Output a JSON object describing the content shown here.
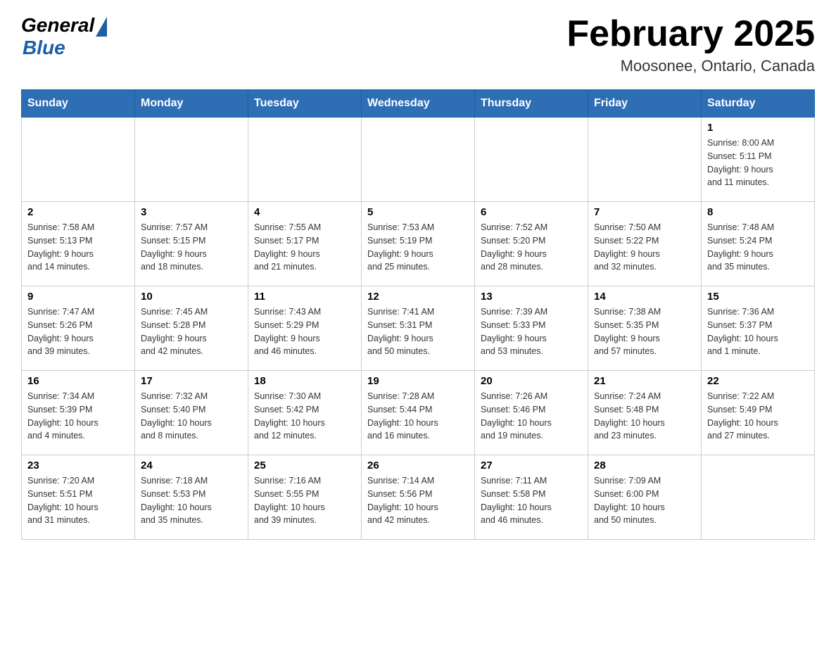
{
  "header": {
    "logo_general": "General",
    "logo_blue": "Blue",
    "month_title": "February 2025",
    "location": "Moosonee, Ontario, Canada"
  },
  "days_of_week": [
    "Sunday",
    "Monday",
    "Tuesday",
    "Wednesday",
    "Thursday",
    "Friday",
    "Saturday"
  ],
  "weeks": [
    [
      {
        "day": "",
        "info": ""
      },
      {
        "day": "",
        "info": ""
      },
      {
        "day": "",
        "info": ""
      },
      {
        "day": "",
        "info": ""
      },
      {
        "day": "",
        "info": ""
      },
      {
        "day": "",
        "info": ""
      },
      {
        "day": "1",
        "info": "Sunrise: 8:00 AM\nSunset: 5:11 PM\nDaylight: 9 hours\nand 11 minutes."
      }
    ],
    [
      {
        "day": "2",
        "info": "Sunrise: 7:58 AM\nSunset: 5:13 PM\nDaylight: 9 hours\nand 14 minutes."
      },
      {
        "day": "3",
        "info": "Sunrise: 7:57 AM\nSunset: 5:15 PM\nDaylight: 9 hours\nand 18 minutes."
      },
      {
        "day": "4",
        "info": "Sunrise: 7:55 AM\nSunset: 5:17 PM\nDaylight: 9 hours\nand 21 minutes."
      },
      {
        "day": "5",
        "info": "Sunrise: 7:53 AM\nSunset: 5:19 PM\nDaylight: 9 hours\nand 25 minutes."
      },
      {
        "day": "6",
        "info": "Sunrise: 7:52 AM\nSunset: 5:20 PM\nDaylight: 9 hours\nand 28 minutes."
      },
      {
        "day": "7",
        "info": "Sunrise: 7:50 AM\nSunset: 5:22 PM\nDaylight: 9 hours\nand 32 minutes."
      },
      {
        "day": "8",
        "info": "Sunrise: 7:48 AM\nSunset: 5:24 PM\nDaylight: 9 hours\nand 35 minutes."
      }
    ],
    [
      {
        "day": "9",
        "info": "Sunrise: 7:47 AM\nSunset: 5:26 PM\nDaylight: 9 hours\nand 39 minutes."
      },
      {
        "day": "10",
        "info": "Sunrise: 7:45 AM\nSunset: 5:28 PM\nDaylight: 9 hours\nand 42 minutes."
      },
      {
        "day": "11",
        "info": "Sunrise: 7:43 AM\nSunset: 5:29 PM\nDaylight: 9 hours\nand 46 minutes."
      },
      {
        "day": "12",
        "info": "Sunrise: 7:41 AM\nSunset: 5:31 PM\nDaylight: 9 hours\nand 50 minutes."
      },
      {
        "day": "13",
        "info": "Sunrise: 7:39 AM\nSunset: 5:33 PM\nDaylight: 9 hours\nand 53 minutes."
      },
      {
        "day": "14",
        "info": "Sunrise: 7:38 AM\nSunset: 5:35 PM\nDaylight: 9 hours\nand 57 minutes."
      },
      {
        "day": "15",
        "info": "Sunrise: 7:36 AM\nSunset: 5:37 PM\nDaylight: 10 hours\nand 1 minute."
      }
    ],
    [
      {
        "day": "16",
        "info": "Sunrise: 7:34 AM\nSunset: 5:39 PM\nDaylight: 10 hours\nand 4 minutes."
      },
      {
        "day": "17",
        "info": "Sunrise: 7:32 AM\nSunset: 5:40 PM\nDaylight: 10 hours\nand 8 minutes."
      },
      {
        "day": "18",
        "info": "Sunrise: 7:30 AM\nSunset: 5:42 PM\nDaylight: 10 hours\nand 12 minutes."
      },
      {
        "day": "19",
        "info": "Sunrise: 7:28 AM\nSunset: 5:44 PM\nDaylight: 10 hours\nand 16 minutes."
      },
      {
        "day": "20",
        "info": "Sunrise: 7:26 AM\nSunset: 5:46 PM\nDaylight: 10 hours\nand 19 minutes."
      },
      {
        "day": "21",
        "info": "Sunrise: 7:24 AM\nSunset: 5:48 PM\nDaylight: 10 hours\nand 23 minutes."
      },
      {
        "day": "22",
        "info": "Sunrise: 7:22 AM\nSunset: 5:49 PM\nDaylight: 10 hours\nand 27 minutes."
      }
    ],
    [
      {
        "day": "23",
        "info": "Sunrise: 7:20 AM\nSunset: 5:51 PM\nDaylight: 10 hours\nand 31 minutes."
      },
      {
        "day": "24",
        "info": "Sunrise: 7:18 AM\nSunset: 5:53 PM\nDaylight: 10 hours\nand 35 minutes."
      },
      {
        "day": "25",
        "info": "Sunrise: 7:16 AM\nSunset: 5:55 PM\nDaylight: 10 hours\nand 39 minutes."
      },
      {
        "day": "26",
        "info": "Sunrise: 7:14 AM\nSunset: 5:56 PM\nDaylight: 10 hours\nand 42 minutes."
      },
      {
        "day": "27",
        "info": "Sunrise: 7:11 AM\nSunset: 5:58 PM\nDaylight: 10 hours\nand 46 minutes."
      },
      {
        "day": "28",
        "info": "Sunrise: 7:09 AM\nSunset: 6:00 PM\nDaylight: 10 hours\nand 50 minutes."
      },
      {
        "day": "",
        "info": ""
      }
    ]
  ]
}
